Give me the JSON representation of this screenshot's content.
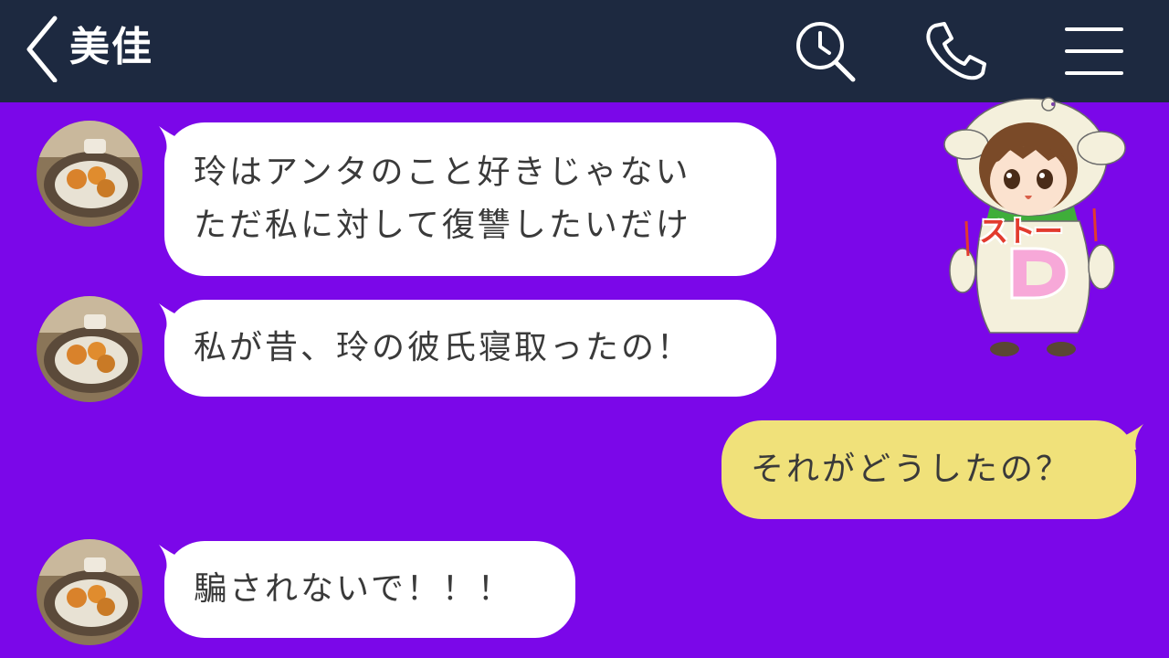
{
  "header": {
    "contact_name": "美佳",
    "icons": [
      "back-chevron-icon",
      "search-history-icon",
      "phone-icon",
      "menu-icon"
    ]
  },
  "colors": {
    "header_bg": "#1d2940",
    "chat_bg": "#7b07e9",
    "incoming_bubble": "#ffffff",
    "outgoing_bubble": "#f0e17a",
    "bubble_text": "#3a3a3a"
  },
  "messages": [
    {
      "direction": "incoming",
      "lines": [
        "玲はアンタのこと好きじゃない",
        "ただ私に対して復讐したいだけ"
      ]
    },
    {
      "direction": "incoming",
      "lines": [
        "私が昔、玲の彼氏寝取ったの！"
      ]
    },
    {
      "direction": "outgoing",
      "lines": [
        "それがどうしたの？"
      ]
    },
    {
      "direction": "incoming",
      "lines": [
        "騙されないで！！！"
      ]
    }
  ],
  "sticker": {
    "text_top": "ストー",
    "text_bottom": "D"
  }
}
